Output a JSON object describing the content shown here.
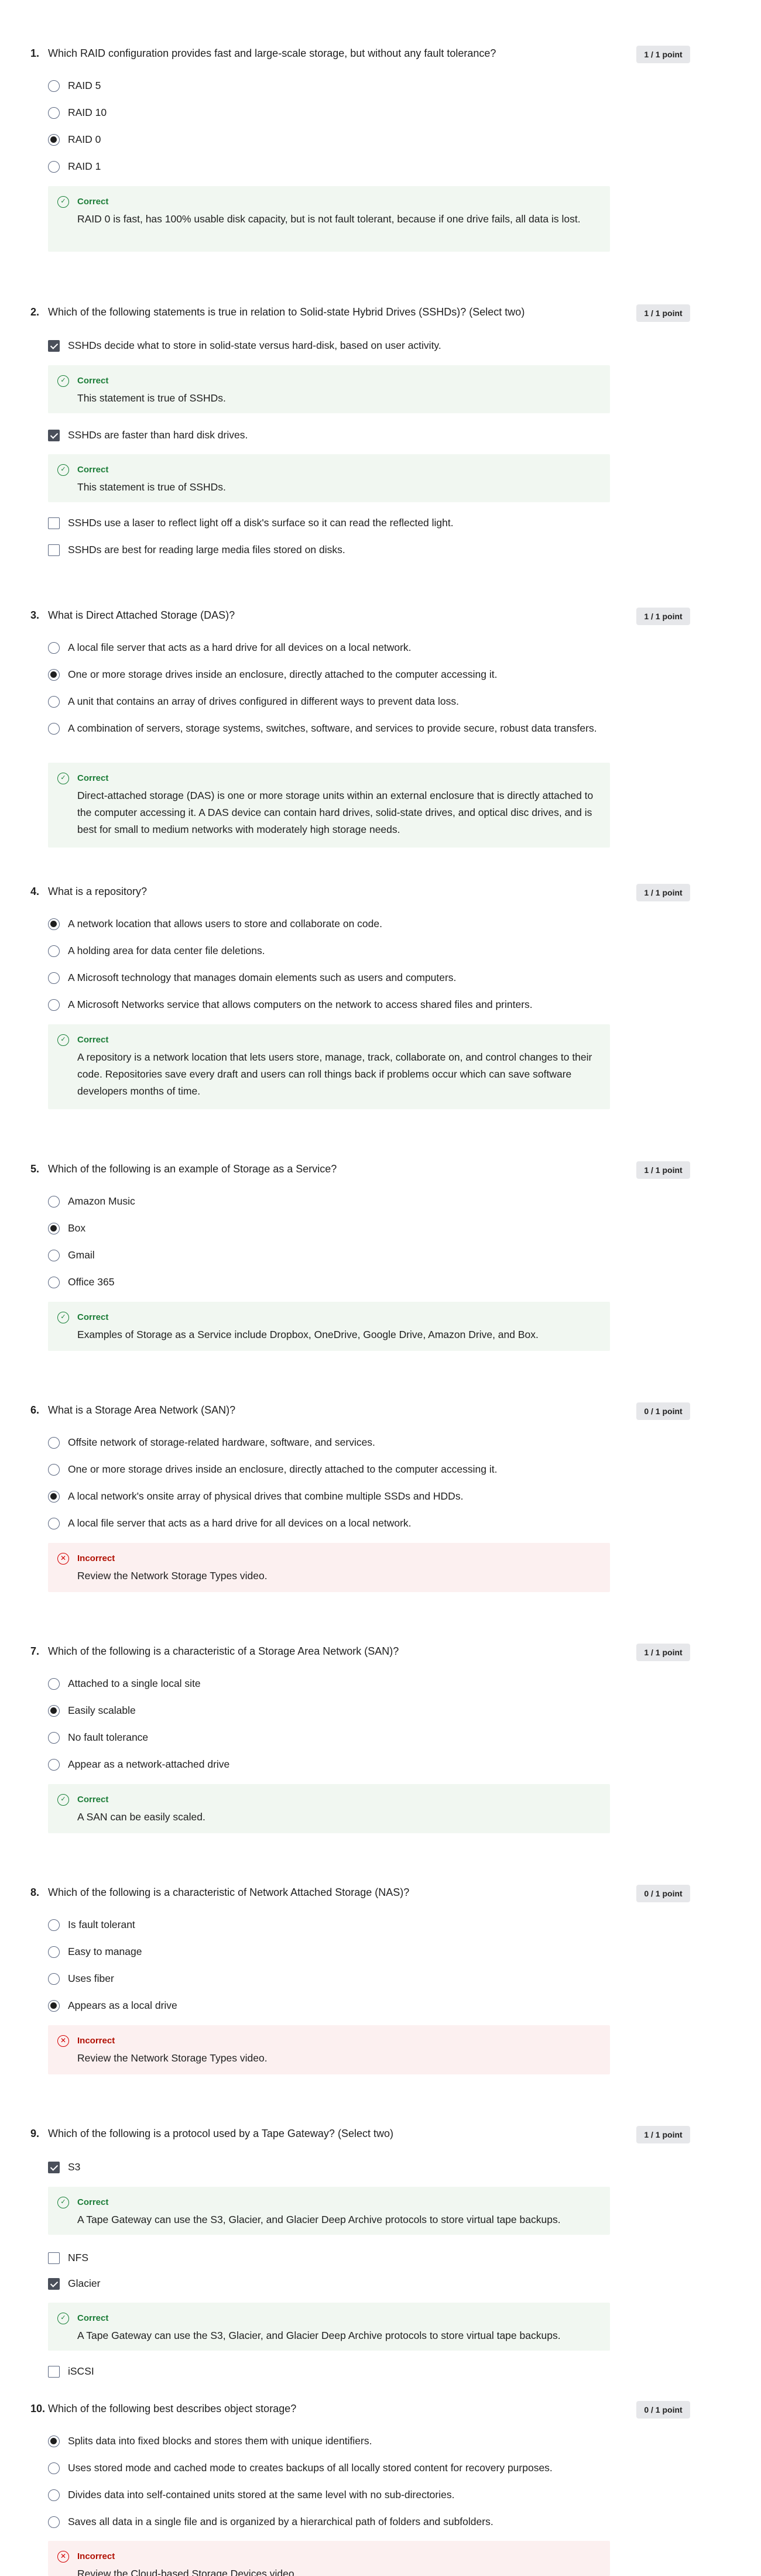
{
  "colors": {
    "correct_green": "#198039",
    "incorrect_red": "#d30001",
    "points_badge_bg": "#e6e7ea"
  },
  "icons": {
    "correct": "check-circle-icon",
    "incorrect": "x-circle-icon",
    "selected_radio": "radio-selected-icon",
    "checked_box": "checkbox-checked-icon"
  },
  "questions": [
    {
      "number": "1.",
      "text": "Which RAID configuration provides fast and large-scale storage, but without any fault tolerance?",
      "points": "1 / 1 point",
      "type": "radio",
      "options": [
        {
          "label": "RAID 5",
          "selected": false
        },
        {
          "label": "RAID 10",
          "selected": false
        },
        {
          "label": "RAID 0",
          "selected": true
        },
        {
          "label": "RAID 1",
          "selected": false
        }
      ],
      "feedback": [
        {
          "status": "Correct",
          "text": "RAID 0 is fast, has 100% usable disk capacity, but is not fault tolerant, because if one drive fails, all data is lost."
        }
      ]
    },
    {
      "number": "2.",
      "text": "Which of the following statements is true in relation to Solid-state Hybrid Drives (SSHDs)? (Select two)",
      "points": "1 / 1 point",
      "type": "checkbox",
      "options": [
        {
          "label": "SSHDs decide what to store in solid-state versus hard-disk, based on user activity.",
          "selected": true
        },
        {
          "label": "SSHDs are faster than hard disk drives.",
          "selected": true
        },
        {
          "label": "SSHDs use a laser to reflect light off a disk's surface so it can read the reflected light.",
          "selected": false
        },
        {
          "label": "SSHDs are best for reading large media files stored on disks.",
          "selected": false
        }
      ],
      "feedback": [
        {
          "status": "Correct",
          "text": "This statement is true of SSHDs."
        },
        {
          "status": "Correct",
          "text": "This statement is true of SSHDs."
        }
      ]
    },
    {
      "number": "3.",
      "text": "What is Direct Attached Storage (DAS)?",
      "points": "1 / 1 point",
      "type": "radio",
      "options": [
        {
          "label": "A local file server that acts as a hard drive for all devices on a local network.",
          "selected": false
        },
        {
          "label": "One or more storage drives inside an enclosure, directly attached to the computer accessing it.",
          "selected": true
        },
        {
          "label": "A unit that contains an array of drives configured in different ways to prevent data loss.",
          "selected": false
        },
        {
          "label": "A combination of servers, storage systems, switches, software, and services to provide secure, robust data transfers.",
          "selected": false
        }
      ],
      "feedback": [
        {
          "status": "Correct",
          "text": "Direct-attached storage (DAS) is one or more storage units within an external enclosure that is directly attached to the computer accessing it. A DAS device can contain hard drives, solid-state drives, and optical disc drives, and is best for small to medium networks with moderately high storage needs."
        }
      ]
    },
    {
      "number": "4.",
      "text": "What is a repository?",
      "points": "1 / 1 point",
      "type": "radio",
      "options": [
        {
          "label": "A network location that allows users to store and collaborate on code.",
          "selected": true
        },
        {
          "label": "A holding area for data center file deletions.",
          "selected": false
        },
        {
          "label": "A Microsoft technology that manages domain elements such as users and computers.",
          "selected": false
        },
        {
          "label": "A Microsoft Networks service that allows computers on the network to access shared files and printers.",
          "selected": false
        }
      ],
      "feedback": [
        {
          "status": "Correct",
          "text": "A repository is a network location that lets users store, manage, track, collaborate on, and control changes to their code. Repositories save every draft and users can roll things back if problems occur which can save software developers months of time."
        }
      ]
    },
    {
      "number": "5.",
      "text": "Which of the following is an example of Storage as a Service?",
      "points": "1 / 1 point",
      "type": "radio",
      "options": [
        {
          "label": "Amazon Music",
          "selected": false
        },
        {
          "label": "Box",
          "selected": true
        },
        {
          "label": "Gmail",
          "selected": false
        },
        {
          "label": "Office 365",
          "selected": false
        }
      ],
      "feedback": [
        {
          "status": "Correct",
          "text": "Examples of Storage as a Service include Dropbox, OneDrive, Google Drive, Amazon Drive, and Box."
        }
      ]
    },
    {
      "number": "6.",
      "text": "What is a Storage Area Network (SAN)?",
      "points": "0 / 1 point",
      "type": "radio",
      "options": [
        {
          "label": "Offsite network of storage-related hardware, software, and services.",
          "selected": false
        },
        {
          "label": "One or more storage drives inside an enclosure, directly attached to the computer accessing it.",
          "selected": false
        },
        {
          "label": "A local network's onsite array of physical drives that combine multiple SSDs and HDDs.",
          "selected": true
        },
        {
          "label": "A local file server that acts as a hard drive for all devices on a local network.",
          "selected": false
        }
      ],
      "feedback": [
        {
          "status": "Incorrect",
          "text": "Review the Network Storage Types video."
        }
      ]
    },
    {
      "number": "7.",
      "text": "Which of the following is a characteristic of a Storage Area Network (SAN)?",
      "points": "1 / 1 point",
      "type": "radio",
      "options": [
        {
          "label": "Attached to a single local site",
          "selected": false
        },
        {
          "label": "Easily scalable",
          "selected": true
        },
        {
          "label": "No fault tolerance",
          "selected": false
        },
        {
          "label": "Appear as a network-attached drive",
          "selected": false
        }
      ],
      "feedback": [
        {
          "status": "Correct",
          "text": "A SAN can be easily scaled."
        }
      ]
    },
    {
      "number": "8.",
      "text": "Which of the following is a characteristic of Network Attached Storage (NAS)?",
      "points": "0 / 1 point",
      "type": "radio",
      "options": [
        {
          "label": "Is fault tolerant",
          "selected": false
        },
        {
          "label": "Easy to manage",
          "selected": false
        },
        {
          "label": "Uses fiber",
          "selected": false
        },
        {
          "label": "Appears as a local drive",
          "selected": true
        }
      ],
      "feedback": [
        {
          "status": "Incorrect",
          "text": "Review the Network Storage Types video."
        }
      ]
    },
    {
      "number": "9.",
      "text": "Which of the following is a protocol used by a Tape Gateway? (Select two)",
      "points": "1 / 1 point",
      "type": "checkbox",
      "options": [
        {
          "label": "S3",
          "selected": true
        },
        {
          "label": "NFS",
          "selected": false
        },
        {
          "label": "Glacier",
          "selected": true
        },
        {
          "label": "iSCSI",
          "selected": false
        }
      ],
      "feedback": [
        {
          "status": "Correct",
          "text": "A Tape Gateway can use the S3, Glacier, and Glacier Deep Archive protocols to store virtual tape backups."
        },
        {
          "status": "Correct",
          "text": "A Tape Gateway can use the S3, Glacier, and Glacier Deep Archive protocols to store virtual tape backups."
        }
      ]
    },
    {
      "number": "10.",
      "text": "Which of the following best describes object storage?",
      "points": "0 / 1 point",
      "type": "radio",
      "options": [
        {
          "label": "Splits data into fixed blocks and stores them with unique identifiers.",
          "selected": true
        },
        {
          "label": "Uses stored mode and cached mode to creates backups of all locally stored content for recovery purposes.",
          "selected": false
        },
        {
          "label": "Divides data into self-contained units stored at the same level with no sub-directories.",
          "selected": false
        },
        {
          "label": "Saves all data in a single file and is organized by a hierarchical path of folders and subfolders.",
          "selected": false
        }
      ],
      "feedback": [
        {
          "status": "Incorrect",
          "text": "Review the Cloud-based Storage Devices video."
        }
      ]
    }
  ]
}
